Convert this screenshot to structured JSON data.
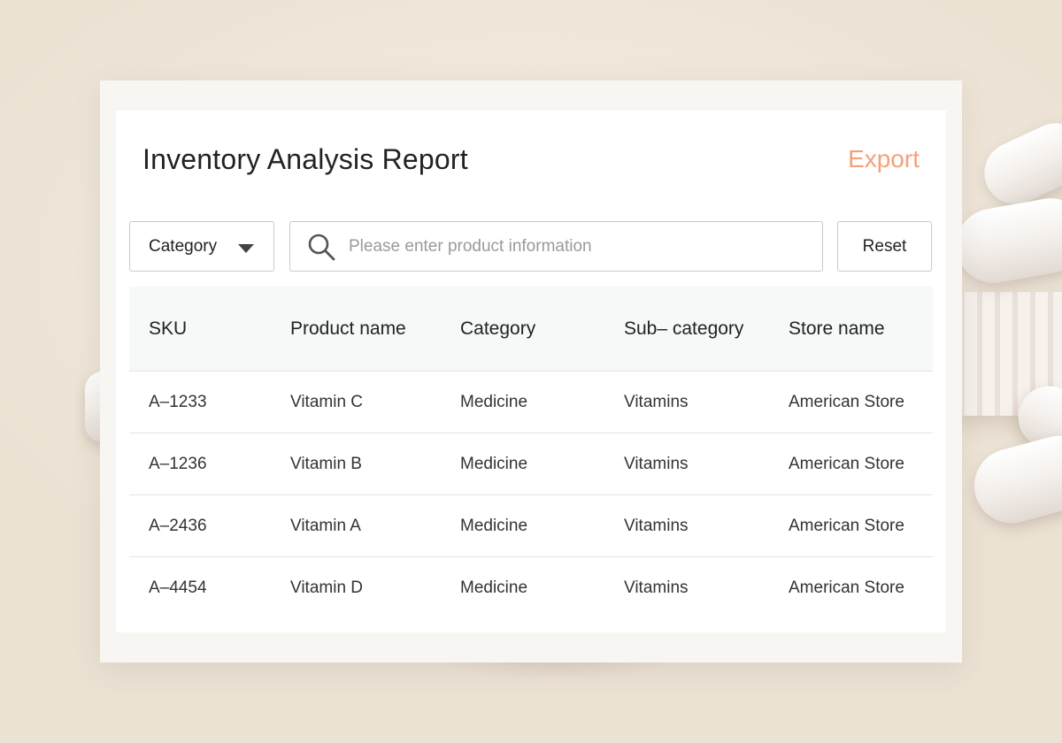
{
  "header": {
    "title": "Inventory Analysis Report",
    "export_label": "Export"
  },
  "filters": {
    "category_label": "Category",
    "search_placeholder": "Please enter product information",
    "search_value": "",
    "reset_label": "Reset"
  },
  "table": {
    "columns": [
      "SKU",
      "Product name",
      "Category",
      "Sub– category",
      "Store name"
    ],
    "rows": [
      [
        "A–1233",
        "Vitamin C",
        "Medicine",
        "Vitamins",
        "American Store"
      ],
      [
        "A–1236",
        "Vitamin B",
        "Medicine",
        "Vitamins",
        "American Store"
      ],
      [
        "A–2436",
        "Vitamin A",
        "Medicine",
        "Vitamins",
        "American Store"
      ],
      [
        "A–4454",
        "Vitamin D",
        "Medicine",
        "Vitamins",
        "American Store"
      ]
    ]
  },
  "colors": {
    "accent": "#f4a07a",
    "background": "#f0e9de",
    "card": "#ffffff",
    "header_row": "#f7f9f8",
    "border": "#c9c9c9"
  },
  "icons": {
    "search": "search-icon",
    "dropdown": "caret-down-icon"
  }
}
